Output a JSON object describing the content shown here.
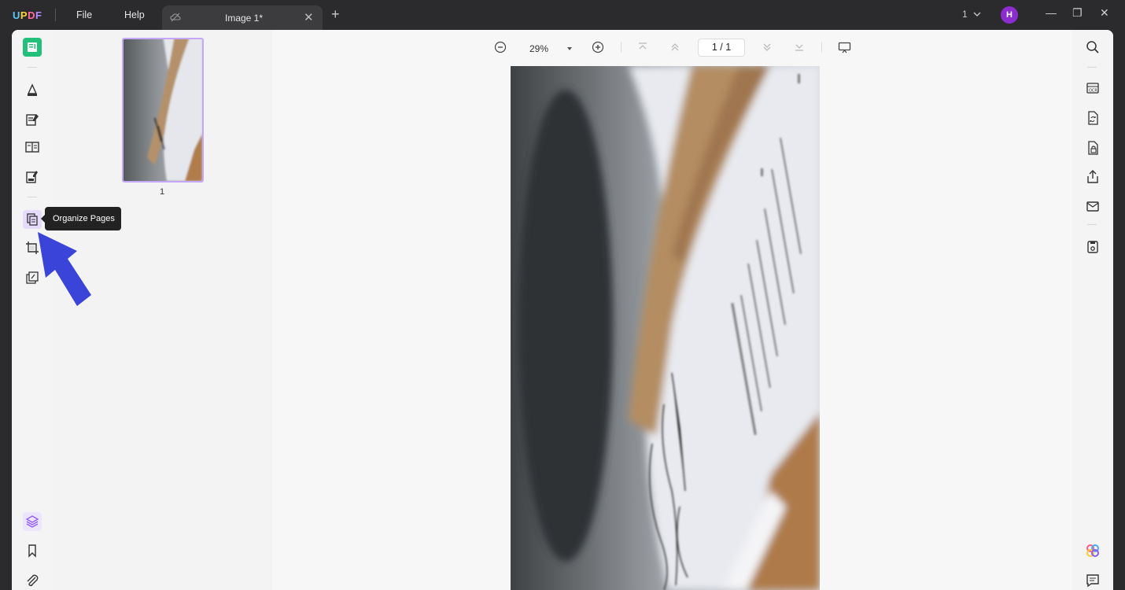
{
  "app": {
    "logo": [
      "U",
      "P",
      "D",
      "F"
    ]
  },
  "menu": {
    "file": "File",
    "help": "Help"
  },
  "tab": {
    "title": "Image 1*",
    "close": "✕",
    "add": "+"
  },
  "window": {
    "page_selector": "1",
    "avatar_letter": "H",
    "minimize": "—",
    "maximize": "❐",
    "close": "✕"
  },
  "toolbar": {
    "zoom_value": "29%",
    "page_indicator": "1 / 1"
  },
  "thumbnails": [
    {
      "label": "1"
    }
  ],
  "tooltip": {
    "text": "Organize Pages"
  },
  "left_rail": {
    "icons": [
      "reader-icon",
      "comment-icon",
      "edit-pdf-icon",
      "page-layout-icon",
      "form-icon",
      "organize-pages-icon",
      "crop-icon",
      "watermark-icon",
      "layers-icon",
      "bookmark-icon",
      "attachment-icon"
    ]
  },
  "right_rail": {
    "icons": [
      "search-icon",
      "ocr-icon",
      "convert-icon",
      "protect-icon",
      "share-icon",
      "email-icon",
      "save-icon",
      "ai-assistant-icon",
      "comments-panel-icon"
    ]
  },
  "colors": {
    "accent": "#8b5cf6",
    "active_green": "#22c07a",
    "arrow": "#3b44d9"
  }
}
